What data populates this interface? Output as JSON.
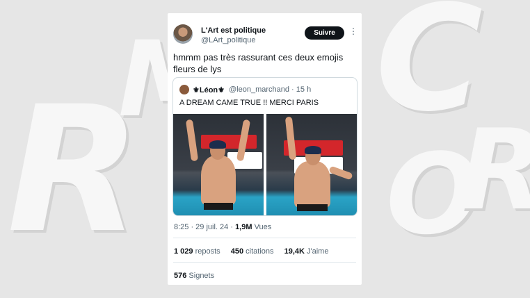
{
  "background": {
    "letters": [
      "R",
      "M",
      "C",
      "O",
      "R"
    ]
  },
  "author": {
    "name": "L'Art est politique",
    "handle": "@LArt_politique"
  },
  "follow_label": "Suivre",
  "more_glyph": "⋮",
  "tweet_text": "hmmm pas très rassurant ces deux emojis fleurs de lys",
  "quote": {
    "name": "⚜Léon⚜",
    "handle": "@leon_marchand · 15 h",
    "text": "A DREAM CAME TRUE !! MERCI PARIS"
  },
  "meta": {
    "time": "8:25 · 29 juil. 24 · ",
    "views_count": "1,9M",
    "views_label": " Vues"
  },
  "stats": [
    {
      "count": "1 029",
      "label": " reposts"
    },
    {
      "count": "450",
      "label": " citations"
    },
    {
      "count": "19,4K",
      "label": " J'aime"
    }
  ],
  "bookmarks": {
    "count": "576",
    "label": " Signets"
  },
  "colors": {
    "follow_bg": "#0f1419",
    "muted": "#536471",
    "pool": "#2aa3c6"
  }
}
